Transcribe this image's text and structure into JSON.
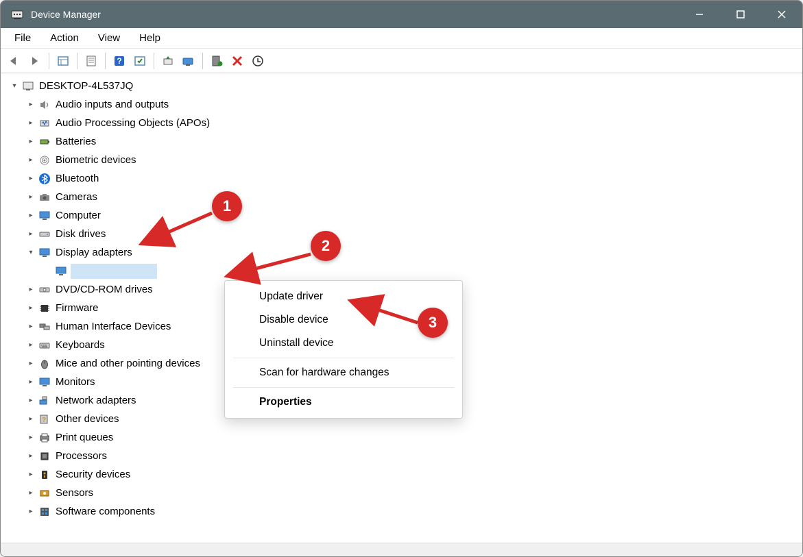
{
  "window": {
    "title": "Device Manager"
  },
  "menu": {
    "file": "File",
    "action": "Action",
    "view": "View",
    "help": "Help"
  },
  "tree": {
    "root": "DESKTOP-4L537JQ",
    "items": [
      {
        "label": "Audio inputs and outputs"
      },
      {
        "label": "Audio Processing Objects (APOs)"
      },
      {
        "label": "Batteries"
      },
      {
        "label": "Biometric devices"
      },
      {
        "label": "Bluetooth"
      },
      {
        "label": "Cameras"
      },
      {
        "label": "Computer"
      },
      {
        "label": "Disk drives"
      },
      {
        "label": "Display adapters",
        "expanded": true
      },
      {
        "label": "DVD/CD-ROM drives"
      },
      {
        "label": "Firmware"
      },
      {
        "label": "Human Interface Devices"
      },
      {
        "label": "Keyboards"
      },
      {
        "label": "Mice and other pointing devices"
      },
      {
        "label": "Monitors"
      },
      {
        "label": "Network adapters"
      },
      {
        "label": "Other devices"
      },
      {
        "label": "Print queues"
      },
      {
        "label": "Processors"
      },
      {
        "label": "Security devices"
      },
      {
        "label": "Sensors"
      },
      {
        "label": "Software components"
      }
    ],
    "selected_child_label": ""
  },
  "context_menu": {
    "update": "Update driver",
    "disable": "Disable device",
    "uninstall": "Uninstall device",
    "scan": "Scan for hardware changes",
    "properties": "Properties"
  },
  "annotations": {
    "b1": "1",
    "b2": "2",
    "b3": "3"
  }
}
